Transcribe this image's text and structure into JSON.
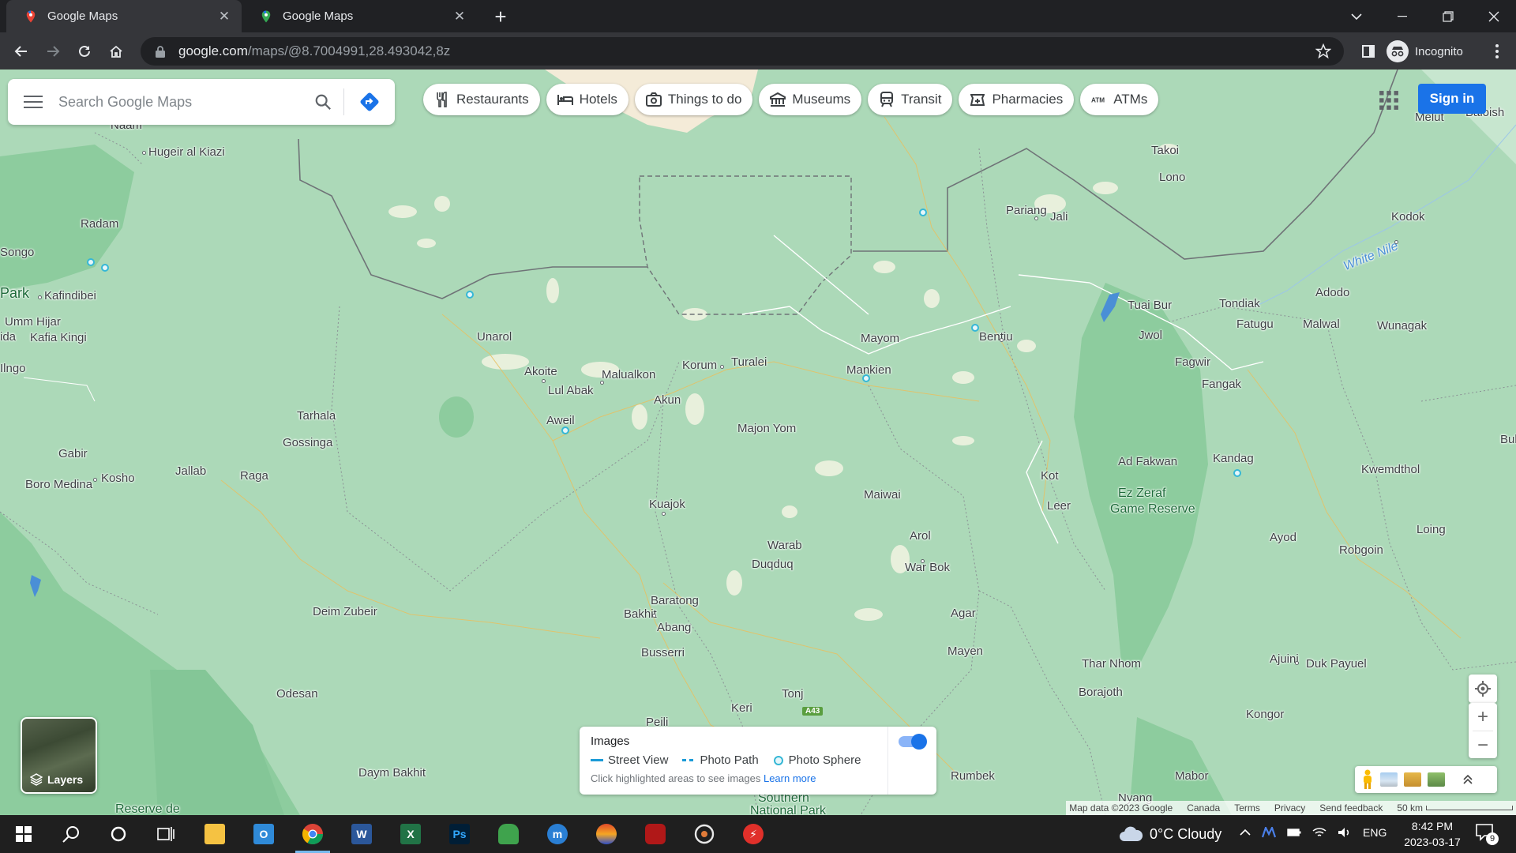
{
  "browser": {
    "tabs": [
      {
        "title": "Google Maps",
        "active": true
      },
      {
        "title": "Google Maps",
        "active": false
      }
    ],
    "url_host": "google.com",
    "url_path": "/maps/@8.7004991,28.493042,8z",
    "profile_label": "Incognito"
  },
  "maps": {
    "search_placeholder": "Search Google Maps",
    "chips": [
      {
        "label": "Restaurants",
        "icon": "fork-knife-icon"
      },
      {
        "label": "Hotels",
        "icon": "bed-icon"
      },
      {
        "label": "Things to do",
        "icon": "camera-icon"
      },
      {
        "label": "Museums",
        "icon": "museum-icon"
      },
      {
        "label": "Transit",
        "icon": "train-icon"
      },
      {
        "label": "Pharmacies",
        "icon": "pharmacy-icon"
      },
      {
        "label": "ATMs",
        "icon": "atm-icon"
      }
    ],
    "sign_in": "Sign in",
    "layers_label": "Layers",
    "places": [
      {
        "name": "Naam"
      },
      {
        "name": "Hugeir al Kiazi"
      },
      {
        "name": "Radam"
      },
      {
        "name": "Songo"
      },
      {
        "name": "Park"
      },
      {
        "name": "Kafindibei"
      },
      {
        "name": "Umm Hijar"
      },
      {
        "name": "Kafia Kingi"
      },
      {
        "name": "Unarol"
      },
      {
        "name": "Akoite"
      },
      {
        "name": "Malualkon"
      },
      {
        "name": "Lul Abak"
      },
      {
        "name": "Akun"
      },
      {
        "name": "Korum"
      },
      {
        "name": "Turalei"
      },
      {
        "name": "Aweil"
      },
      {
        "name": "Majon Yom"
      },
      {
        "name": "Mayom"
      },
      {
        "name": "Mankien"
      },
      {
        "name": "Bentiu"
      },
      {
        "name": "Pariang"
      },
      {
        "name": "Jali"
      },
      {
        "name": "Takoi"
      },
      {
        "name": "Lono"
      },
      {
        "name": "Tuai Bur"
      },
      {
        "name": "Jwol"
      },
      {
        "name": "Fagwir"
      },
      {
        "name": "Fangak"
      },
      {
        "name": "Tondiak"
      },
      {
        "name": "Fatugu"
      },
      {
        "name": "Malwal"
      },
      {
        "name": "Adodo"
      },
      {
        "name": "Wunagak"
      },
      {
        "name": "Kodok"
      },
      {
        "name": "Melut"
      },
      {
        "name": "Baloish"
      },
      {
        "name": "Tarhala"
      },
      {
        "name": "Gossinga"
      },
      {
        "name": "Gabir"
      },
      {
        "name": "Kosho"
      },
      {
        "name": "Jallab"
      },
      {
        "name": "Raga"
      },
      {
        "name": "Boro Medina"
      },
      {
        "name": "Kuajok"
      },
      {
        "name": "Maiwai"
      },
      {
        "name": "Warab"
      },
      {
        "name": "Duqduq"
      },
      {
        "name": "Arol"
      },
      {
        "name": "War Bok"
      },
      {
        "name": "Ad Fakwan"
      },
      {
        "name": "Kandag"
      },
      {
        "name": "Kwemdthol"
      },
      {
        "name": "Kot"
      },
      {
        "name": "Leer"
      },
      {
        "name": "Ayod"
      },
      {
        "name": "Robgoin"
      },
      {
        "name": "Loing"
      },
      {
        "name": "Deim Zubeir"
      },
      {
        "name": "Baratong"
      },
      {
        "name": "Bakhit"
      },
      {
        "name": "Abang"
      },
      {
        "name": "Busserri"
      },
      {
        "name": "Agar"
      },
      {
        "name": "Mayen"
      },
      {
        "name": "Thar Nhom"
      },
      {
        "name": "Borajoth"
      },
      {
        "name": "Ajuini"
      },
      {
        "name": "Duk Payuel"
      },
      {
        "name": "Odesan"
      },
      {
        "name": "Tonj"
      },
      {
        "name": "Keri"
      },
      {
        "name": "Peili"
      },
      {
        "name": "Daym Bakhit"
      },
      {
        "name": "Rumbek"
      },
      {
        "name": "Mabor"
      },
      {
        "name": "Kongor"
      },
      {
        "name": "Nyang"
      },
      {
        "name": "Ilngo"
      },
      {
        "name": "ida"
      },
      {
        "name": "Bul"
      }
    ],
    "park_labels": [
      "Ez Zeraf",
      "Game Reserve"
    ],
    "bottom_labels": [
      "Southern",
      "National Park",
      "Reserve de"
    ],
    "water_label": "White Nile",
    "highway_label": "A43",
    "images_panel": {
      "title": "Images",
      "legend": [
        "Street View",
        "Photo Path",
        "Photo Sphere"
      ],
      "hint": "Click highlighted areas to see images",
      "learn_more": "Learn more",
      "toggle_on": true
    },
    "attribution": {
      "map_data": "Map data ©2023 Google",
      "links": [
        "Canada",
        "Terms",
        "Privacy",
        "Send feedback"
      ],
      "scale": "50 km"
    }
  },
  "taskbar": {
    "apps": [
      "start-icon",
      "search-icon",
      "cortana-icon",
      "task-view-icon",
      "file-explorer-icon",
      "outlook-icon",
      "chrome-icon",
      "word-icon",
      "excel-icon",
      "photoshop-icon",
      "game-icon",
      "mu-icon",
      "app-icon",
      "red-app-icon",
      "media-icon",
      "flash-icon"
    ],
    "weather": "0°C  Cloudy",
    "language": "ENG",
    "time": "8:42 PM",
    "date": "2023-03-17",
    "notifications": "9"
  },
  "colors": {
    "map_green": "#acd9b8",
    "accent_blue": "#1a73e8",
    "chrome_dark": "#202124",
    "taskbar": "#1f1f1f"
  }
}
